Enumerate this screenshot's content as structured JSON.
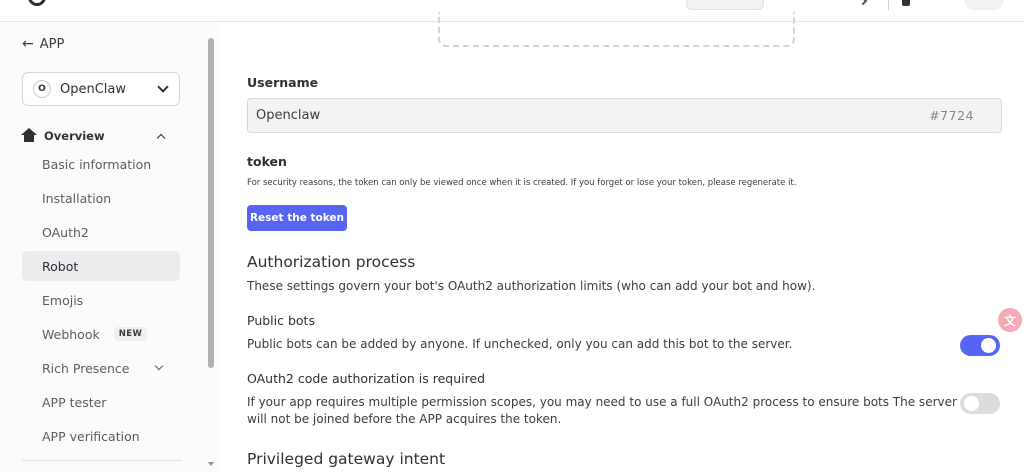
{
  "sidebar": {
    "back_label": "APP",
    "app_selector": {
      "avatar_letter": "O",
      "name": "OpenClaw"
    },
    "section": {
      "label": "Overview"
    },
    "items": [
      {
        "label": "Basic information"
      },
      {
        "label": "Installation"
      },
      {
        "label": "OAuth2"
      },
      {
        "label": "Robot",
        "active": true
      },
      {
        "label": "Emojis"
      },
      {
        "label": "Webhook",
        "badge": "NEW"
      },
      {
        "label": "Rich Presence",
        "expandable": true
      },
      {
        "label": "APP tester"
      },
      {
        "label": "APP verification"
      }
    ]
  },
  "bot": {
    "username_label": "Username",
    "username_value": "Openclaw",
    "discriminator": "#7724",
    "token_label": "token",
    "token_help": "For security reasons, the token can only be viewed once when it is created. If you forget or lose your token, please regenerate it.",
    "reset_token_label": "Reset the token"
  },
  "authorization": {
    "title": "Authorization process",
    "description": "These settings govern your bot's OAuth2 authorization limits (who can add your bot and how).",
    "public_bots": {
      "label": "Public bots",
      "description": "Public bots can be added by anyone. If unchecked, only you can add this bot to the server.",
      "enabled": true
    },
    "code_grant": {
      "label": "OAuth2 code authorization is required",
      "description_line1": "If your app requires multiple permission scopes, you may need to use a full OAuth2 process to ensure bots The server",
      "description_line2": "will not be joined before the APP acquires the token.",
      "enabled": false
    }
  },
  "gateway": {
    "title": "Privileged gateway intent"
  },
  "colors": {
    "accent": "#5865f2",
    "sidebar_bg": "#fbfbfb",
    "active_item_bg": "#ececee",
    "toggle_off": "#dcdcdf",
    "translate_fab": "#f6a9b6"
  },
  "icons": {
    "back": "arrow-left-icon",
    "overview": "home-icon",
    "translate": "translate-icon"
  }
}
